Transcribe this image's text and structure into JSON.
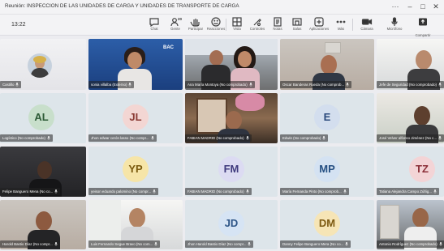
{
  "window": {
    "title": "Reunión: INSPECCIÓN DE LAS UNIDADES DE CARGA Y UNIDADES DE TRANSPORTE DE CARGA",
    "more": "···",
    "minimize": "–",
    "maximize": "□",
    "close": "✕"
  },
  "toolbar": {
    "timer": "13:22",
    "buttons": [
      {
        "label": "Chat",
        "icon": "chat-icon"
      },
      {
        "label": "Gente",
        "icon": "people-icon",
        "count": "20"
      },
      {
        "label": "Participar",
        "icon": "raise-hand-icon"
      },
      {
        "label": "Reacciones",
        "icon": "smile-icon"
      },
      {
        "label": "Vista",
        "icon": "grid-view-icon"
      },
      {
        "label": "Controles",
        "icon": "controls-icon"
      },
      {
        "label": "Notas",
        "icon": "notes-icon"
      },
      {
        "label": "Salas",
        "icon": "rooms-icon"
      },
      {
        "label": "Aplicaciones",
        "icon": "apps-icon"
      },
      {
        "label": "Más",
        "icon": "more-icon"
      },
      {
        "label": "Cámara",
        "icon": "camera-icon"
      },
      {
        "label": "Micrófono",
        "icon": "microphone-icon"
      },
      {
        "label": "Compartir",
        "icon": "share-icon"
      }
    ]
  },
  "participants": [
    {
      "name": "Castillo",
      "kind": "photo"
    },
    {
      "name": "sonia villalba (Externo)",
      "kind": "video"
    },
    {
      "name": "Ana María Montoya (No comprobado)",
      "kind": "video"
    },
    {
      "name": "Oscar Banderas Rueda (No comprob...",
      "kind": "video"
    },
    {
      "name": "Jefe de Seguridad (No comprobado)",
      "kind": "video"
    },
    {
      "name": "Logístico (No comprobado)",
      "kind": "avatar",
      "initials": "AL"
    },
    {
      "name": "Jhon edwar cerón lasso (No compr...",
      "kind": "avatar",
      "initials": "JL"
    },
    {
      "name": "FABIAN MADRID (No comprobado)",
      "kind": "video"
    },
    {
      "name": "Edwin (No comprobado)",
      "kind": "avatar",
      "initials": "E"
    },
    {
      "name": "José Velver alfonso Jiménez (No c...",
      "kind": "video"
    },
    {
      "name": "Felipe Banguero Mena (No co...",
      "kind": "video"
    },
    {
      "name": "yeison eduardo palomino (No compr...",
      "kind": "avatar",
      "initials": "YP"
    },
    {
      "name": "FABIAN MADRID (No comprobado)",
      "kind": "avatar",
      "initials": "FM"
    },
    {
      "name": "María Fernanda Pinto (No comprob...",
      "kind": "avatar",
      "initials": "MP"
    },
    {
      "name": "Tatiana Alejandra Campo Zúñig...",
      "kind": "avatar",
      "initials": "TZ"
    },
    {
      "name": "Harold Bastio Díaz (No compr...",
      "kind": "video"
    },
    {
      "name": "Luis Fernando Segue Bravo (No com...",
      "kind": "video"
    },
    {
      "name": "Jhon Harold Bastio Díaz (No compr...",
      "kind": "avatar",
      "initials": "JD"
    },
    {
      "name": "Danny Felipe Banguero Mera (No co...",
      "kind": "avatar",
      "initials": "DM"
    },
    {
      "name": "Antonio Rodríguez (No comprobado)",
      "kind": "video"
    }
  ],
  "bac_logo": "BAC",
  "colors": {
    "toolbar_bg": "#f3f3f5",
    "grid_bg": "#ececf0",
    "name_tag": "#202020"
  }
}
